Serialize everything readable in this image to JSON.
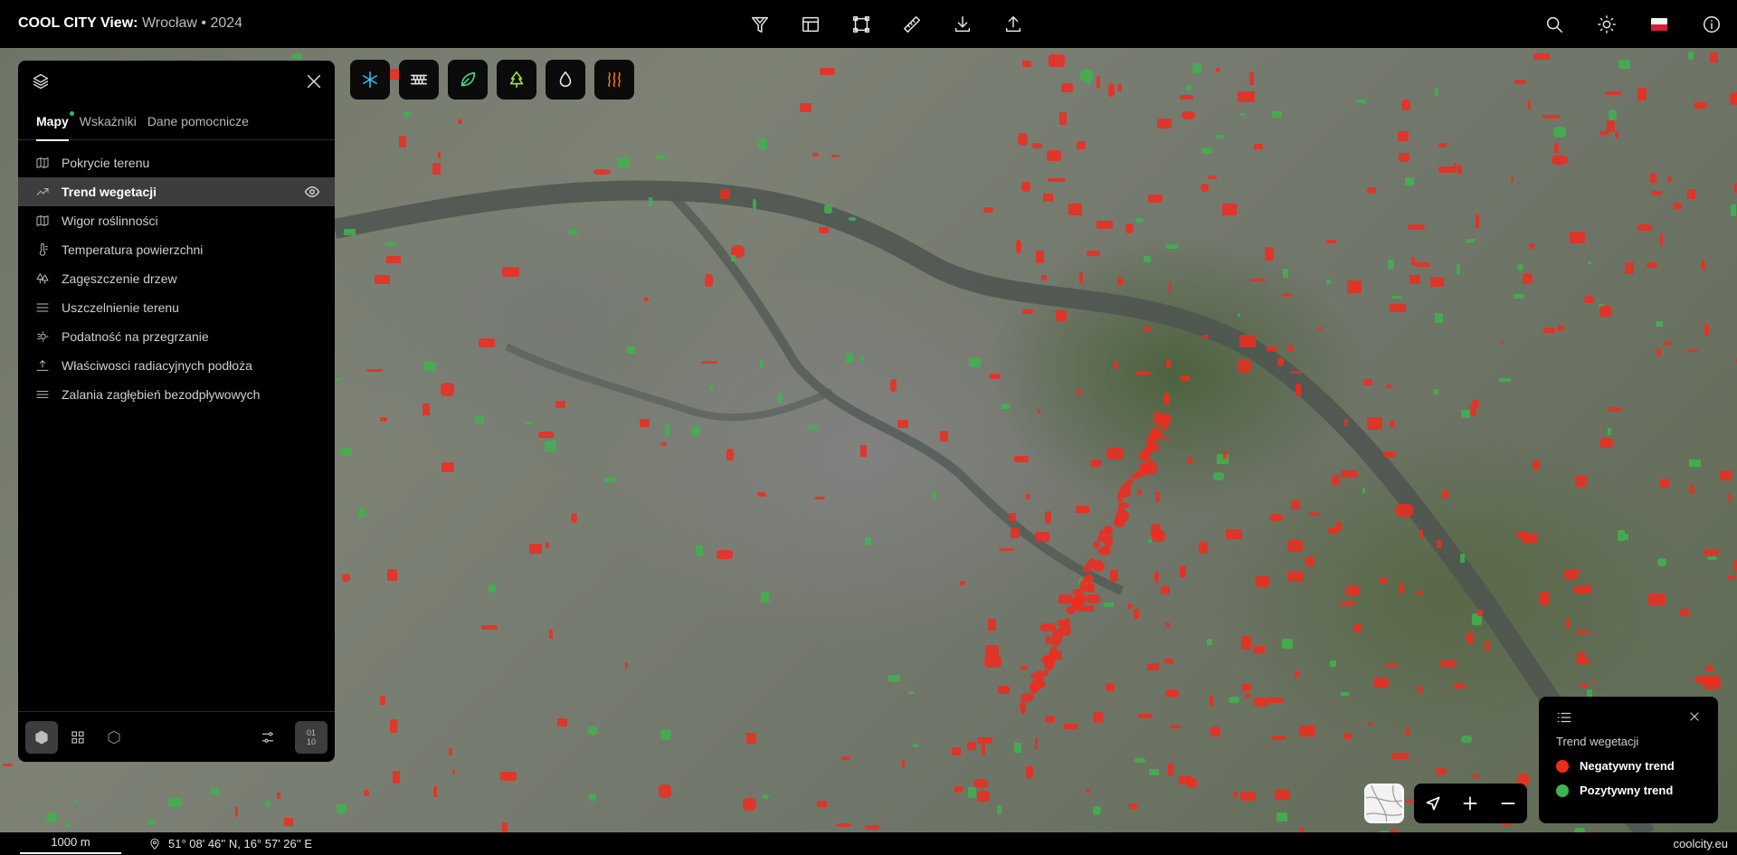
{
  "header": {
    "brand_bold": "COOL CITY View:",
    "brand_sub": "Wrocław • 2024",
    "tools": [
      "filter-icon",
      "layout-icon",
      "select-area-icon",
      "ruler-icon",
      "download-icon",
      "upload-icon"
    ],
    "right": [
      "search-icon",
      "sun-icon",
      "flag-pl",
      "info-icon"
    ]
  },
  "map_tools": [
    {
      "icon": "snowflake-icon",
      "color": "#38bdf8"
    },
    {
      "icon": "paving-icon",
      "color": "#e5e5e5"
    },
    {
      "icon": "leaf-icon",
      "color": "#4ade80"
    },
    {
      "icon": "tree-icon",
      "color": "#a3e635"
    },
    {
      "icon": "drop-icon",
      "color": "#e5e5e5"
    },
    {
      "icon": "heat-icon",
      "color": "#f97316"
    }
  ],
  "panel": {
    "tabs": [
      "Mapy",
      "Wskaźniki",
      "Dane pomocnicze"
    ],
    "active_tab": "Mapy",
    "items": [
      {
        "label": "Pokrycie terenu",
        "icon": "map-icon"
      },
      {
        "label": "Trend wegetacji",
        "icon": "trend-icon",
        "active": true
      },
      {
        "label": "Wigor roślinności",
        "icon": "map-icon"
      },
      {
        "label": "Temperatura powierzchni",
        "icon": "thermometer-icon"
      },
      {
        "label": "Zagęszczenie drzew",
        "icon": "trees-icon"
      },
      {
        "label": "Uszczelnienie terenu",
        "icon": "lines-icon"
      },
      {
        "label": "Podatność na przegrzanie",
        "icon": "overheat-icon"
      },
      {
        "label": "Właściwosci radiacyjnych podłoża",
        "icon": "radiation-icon"
      },
      {
        "label": "Zalania zagłębień bezodpływowych",
        "icon": "waves-icon"
      }
    ],
    "footer_number": [
      "01",
      "10"
    ]
  },
  "legend": {
    "title": "Trend wegetacji",
    "entries": [
      {
        "label": "Negatywny trend",
        "color": "#ef2b1e"
      },
      {
        "label": "Pozytywny trend",
        "color": "#3fb34f"
      }
    ]
  },
  "bottom": {
    "scale": "1000 m",
    "coords": "51° 08' 46'' N, 16° 57' 26'' E",
    "site": "coolcity.eu"
  }
}
